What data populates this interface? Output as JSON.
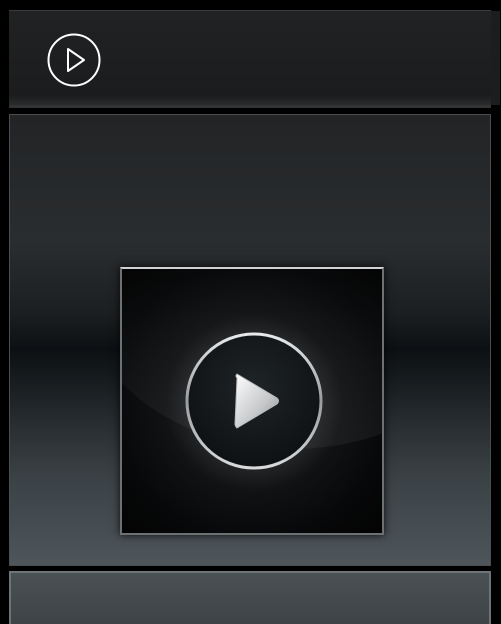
{
  "top_bar": {
    "icon": "play-circle-icon"
  },
  "video_tile": {
    "icon": "play-button-icon"
  },
  "colors": {
    "top_bar_bg": "#1e1f21",
    "panel_mid_dark": "#0c1013",
    "panel_bottom": "#4e565b",
    "tile_border": "#6e7174",
    "icon_stroke": "#ffffff"
  }
}
